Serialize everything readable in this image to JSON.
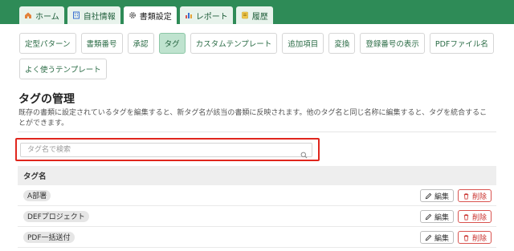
{
  "top_tabs": [
    {
      "label": "ホーム",
      "icon": "home-icon",
      "active": false
    },
    {
      "label": "自社情報",
      "icon": "building-icon",
      "active": false
    },
    {
      "label": "書類設定",
      "icon": "gear-icon",
      "active": true
    },
    {
      "label": "レポート",
      "icon": "chart-icon",
      "active": false
    },
    {
      "label": "履歴",
      "icon": "history-icon",
      "active": false
    }
  ],
  "sub_tabs": [
    {
      "label": "定型パターン",
      "active": false
    },
    {
      "label": "書類番号",
      "active": false
    },
    {
      "label": "承認",
      "active": false
    },
    {
      "label": "タグ",
      "active": true
    },
    {
      "label": "カスタムテンプレート",
      "active": false
    },
    {
      "label": "追加項目",
      "active": false
    },
    {
      "label": "変換",
      "active": false
    },
    {
      "label": "登録番号の表示",
      "active": false
    },
    {
      "label": "PDFファイル名",
      "active": false
    },
    {
      "label": "よく使うテンプレート",
      "active": false
    }
  ],
  "page": {
    "title": "タグの管理",
    "description": "既存の書類に設定されているタグを編集すると、新タグ名が該当の書類に反映されます。他のタグ名と同じ名称に編集すると、タグを統合することができます。"
  },
  "search": {
    "placeholder": "タグ名で検索",
    "value": ""
  },
  "table": {
    "header": "タグ名",
    "rows": [
      {
        "tag": "A部署"
      },
      {
        "tag": "DEFプロジェクト"
      },
      {
        "tag": "PDF一括送付"
      }
    ],
    "edit_label": "編集",
    "delete_label": "削除"
  },
  "colors": {
    "brand": "#2e8b57",
    "active_subtab": "#bfe3cf",
    "highlight": "#e0261d",
    "danger": "#c9302c"
  }
}
